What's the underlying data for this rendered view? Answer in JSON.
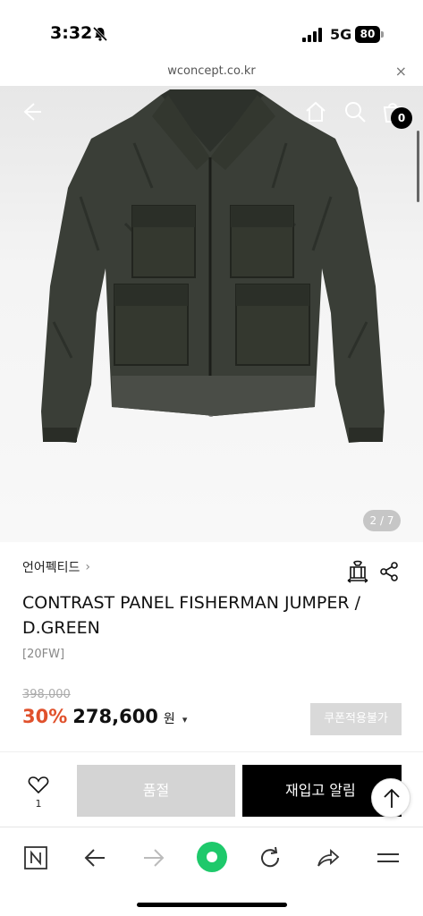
{
  "status_bar": {
    "time": "3:32",
    "network": "5G",
    "battery": "80"
  },
  "url_bar": {
    "domain": "wconcept.co.kr",
    "close": "×"
  },
  "header": {
    "cart_count": "0"
  },
  "gallery": {
    "page_indicator": "2 / 7"
  },
  "product": {
    "brand": "언어펙티드",
    "title": "CONTRAST PANEL FISHERMAN JUMPER / D.GREEN",
    "season": "[20FW]",
    "original_price": "398,000",
    "discount_rate": "30%",
    "sale_price": "278,600",
    "currency": "원",
    "coupon_label": "쿠폰적용불가"
  },
  "actions": {
    "like_count": "1",
    "soldout_label": "품절",
    "restock_label": "재입고 알림"
  },
  "colors": {
    "accent": "#e0512c",
    "browser_green": "#1ec96b"
  },
  "icons": {
    "status": [
      "bell-slash-icon",
      "signal-icon",
      "battery-icon"
    ],
    "header": [
      "back-arrow-icon",
      "home-icon",
      "search-icon",
      "cart-icon"
    ],
    "product": [
      "hanger-icon",
      "share-icon",
      "chevron-right-icon"
    ],
    "toolbar": [
      "naver-n-icon",
      "back-icon",
      "forward-icon",
      "green-dot-icon",
      "refresh-icon",
      "share-arrow-icon",
      "menu-icon"
    ]
  }
}
